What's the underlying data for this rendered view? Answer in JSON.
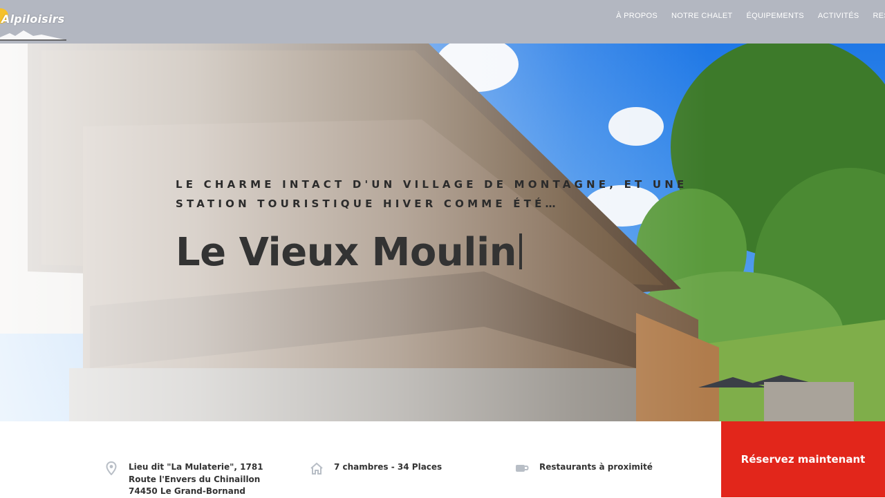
{
  "header": {
    "logo_text": "Alpiloisirs",
    "nav": [
      "À PROPOS",
      "NOTRE CHALET",
      "ÉQUIPEMENTS",
      "ACTIVITÉS",
      "RES"
    ]
  },
  "hero": {
    "tagline_line1": "LE CHARME INTACT D'UN VILLAGE DE MONTAGNE, ET UNE",
    "tagline_line2": "STATION TOURISTIQUE HIVER COMME ÉTÉ…",
    "title": "Le Vieux Moulin"
  },
  "info": {
    "address": {
      "icon": "map-pin-icon",
      "line1": "Lieu dit \"La Mulaterie\", 1781",
      "line2": "Route l'Envers du Chinaillon",
      "line3": "74450 Le Grand-Bornand"
    },
    "rooms": {
      "icon": "house-icon",
      "text": "7 chambres - 34 Places"
    },
    "restaurants": {
      "icon": "coffee-cup-icon",
      "text": "Restaurants à proximité"
    }
  },
  "cta": {
    "label": "Réservez maintenant",
    "color": "#e2261b"
  }
}
